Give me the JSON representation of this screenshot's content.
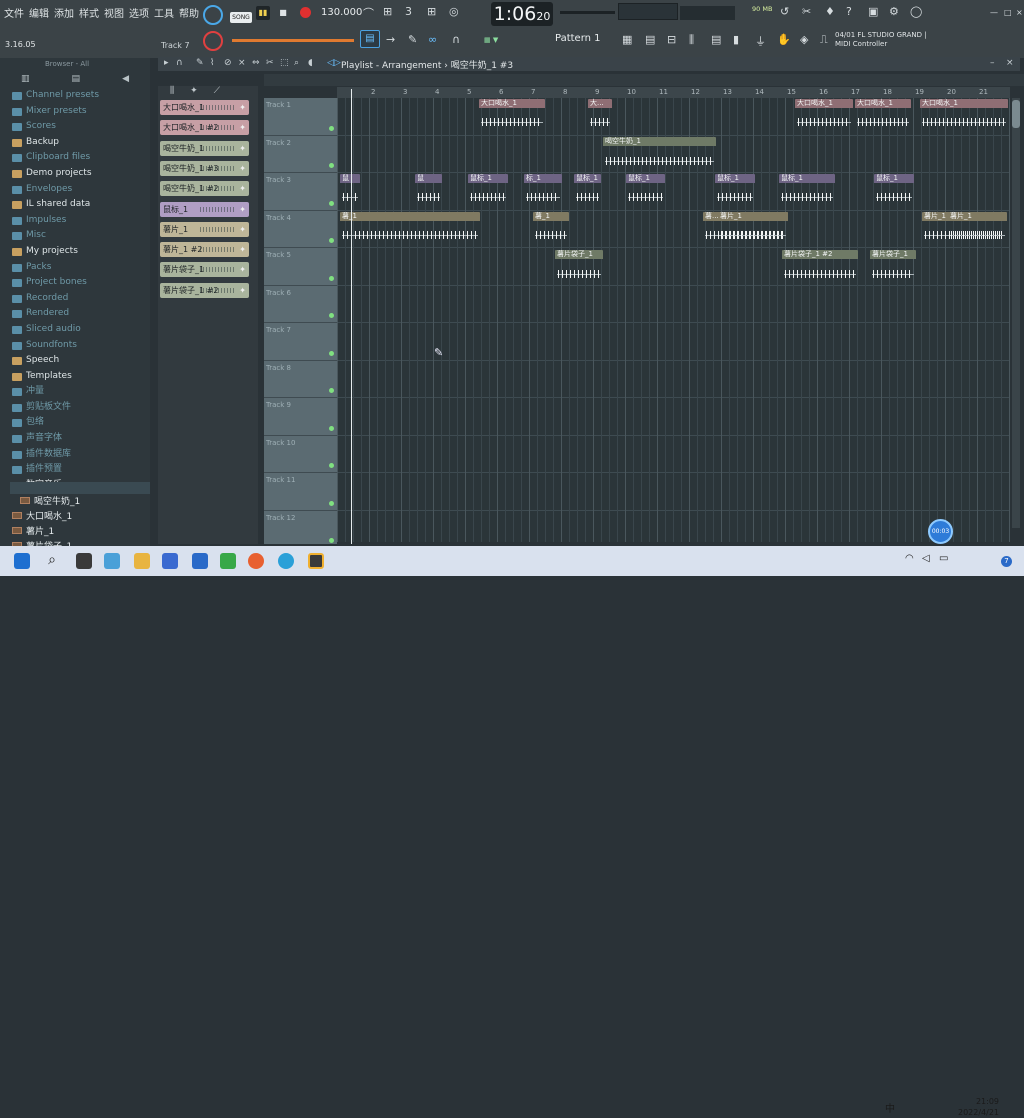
{
  "menu": {
    "items": [
      "文件",
      "编辑",
      "添加",
      "样式",
      "视图",
      "选项",
      "工具",
      "帮助"
    ]
  },
  "transport": {
    "song_label": "SONG",
    "play_symbol": "▮▮",
    "stop_symbol": "■",
    "tempo": "130.000",
    "time": "1:06",
    "time_sub": "20",
    "memory": "90 MB"
  },
  "hint_bar": {
    "left": "3.16.05",
    "track": "Track 7",
    "hint_line1": "04/01  FL STUDIO GRAND |",
    "hint_line2": "MIDI Controller"
  },
  "pattern": {
    "label": "Pattern 1",
    "snap_icon": "magnet-icon"
  },
  "browser": {
    "header": "Browser - All",
    "items": [
      {
        "label": "Channel presets",
        "style": "dim",
        "color": "#5a8fa8"
      },
      {
        "label": "Mixer presets",
        "style": "dim",
        "color": "#5a8fa8"
      },
      {
        "label": "Scores",
        "style": "dim",
        "color": "#5a8fa8"
      },
      {
        "label": "Backup",
        "style": "brt",
        "color": "#c8a060"
      },
      {
        "label": "Clipboard files",
        "style": "dim",
        "color": "#5a8fa8"
      },
      {
        "label": "Demo projects",
        "style": "brt",
        "color": "#c8a060"
      },
      {
        "label": "Envelopes",
        "style": "dim",
        "color": "#5a8fa8"
      },
      {
        "label": "IL shared data",
        "style": "brt",
        "color": "#c8a060"
      },
      {
        "label": "Impulses",
        "style": "dim",
        "color": "#5a8fa8"
      },
      {
        "label": "Misc",
        "style": "dim",
        "color": "#5a8fa8"
      },
      {
        "label": "My projects",
        "style": "brt",
        "color": "#c8a060"
      },
      {
        "label": "Packs",
        "style": "dim",
        "color": "#5a8fa8"
      },
      {
        "label": "Project bones",
        "style": "dim",
        "color": "#5a8fa8"
      },
      {
        "label": "Recorded",
        "style": "dim",
        "color": "#5a8fa8"
      },
      {
        "label": "Rendered",
        "style": "dim",
        "color": "#5a8fa8"
      },
      {
        "label": "Sliced audio",
        "style": "dim",
        "color": "#5a8fa8"
      },
      {
        "label": "Soundfonts",
        "style": "dim",
        "color": "#5a8fa8"
      },
      {
        "label": "Speech",
        "style": "brt",
        "color": "#c8a060"
      },
      {
        "label": "Templates",
        "style": "brt",
        "color": "#c8a060"
      },
      {
        "label": "冲量",
        "style": "dim",
        "color": "#5a8fa8"
      },
      {
        "label": "剪贴板文件",
        "style": "dim",
        "color": "#5a8fa8"
      },
      {
        "label": "包络",
        "style": "dim",
        "color": "#5a8fa8"
      },
      {
        "label": "声音字体",
        "style": "dim",
        "color": "#5a8fa8"
      },
      {
        "label": "插件数据库",
        "style": "dim",
        "color": "#5a8fa8"
      },
      {
        "label": "插件预置",
        "style": "dim",
        "color": "#5a8fa8"
      },
      {
        "label": "数字音乐",
        "style": "brt",
        "color": "#c8a060"
      }
    ],
    "files": [
      "喝空牛奶_1",
      "大口喝水_1",
      "薯片_1",
      "薯片袋子_1"
    ]
  },
  "playlist": {
    "title": "Playlist - Arrangement",
    "pattern": "喝空牛奶_1 #3",
    "ruler": [
      "2",
      "3",
      "4",
      "5",
      "6",
      "7",
      "8",
      "9",
      "10",
      "11",
      "12",
      "13",
      "14",
      "15",
      "16",
      "17",
      "18",
      "19",
      "20",
      "21"
    ],
    "tracks": [
      "Track 1",
      "Track 2",
      "Track 3",
      "Track 4",
      "Track 5",
      "Track 6",
      "Track 7",
      "Track 8",
      "Track 9",
      "Track 10",
      "Track 11",
      "Track 12"
    ]
  },
  "channels": [
    {
      "label": "大口喝水_1",
      "color": "#c79fa5"
    },
    {
      "label": "大口喝水_1 #2",
      "color": "#c79fa5"
    },
    {
      "label": "喝空牛奶_1",
      "color": "#a9b49d"
    },
    {
      "label": "喝空牛奶_1 #3",
      "color": "#a9b49d"
    },
    {
      "label": "喝空牛奶_1 #2",
      "color": "#a9b49d"
    },
    {
      "label": "鼠标_1",
      "color": "#b09ec4"
    },
    {
      "label": "薯片_1",
      "color": "#bfb698"
    },
    {
      "label": "薯片_1 #2",
      "color": "#bfb698"
    },
    {
      "label": "薯片袋子_1",
      "color": "#a9b49d"
    },
    {
      "label": "薯片袋子_1 #2",
      "color": "#a9b49d"
    }
  ],
  "clips": {
    "row0": [
      [
        "大口喝水_1",
        "#c79fa5"
      ],
      [
        "大...",
        "#c79fa5"
      ],
      [
        "大口喝水_1",
        "#c79fa5"
      ],
      [
        "大口喝水_1",
        "#c79fa5"
      ],
      [
        "大口喝水_1",
        "#c79fa5"
      ]
    ],
    "row1": [
      [
        "喝空牛奶_1",
        "#a9b49d"
      ]
    ],
    "row2": [
      [
        "鼠",
        "#b09ec4"
      ],
      [
        "鼠",
        "#b09ec4"
      ],
      [
        "鼠标_1",
        "#b09ec4"
      ],
      [
        "标_1",
        "#b09ec4"
      ],
      [
        "鼠标_1",
        "#b09ec4"
      ],
      [
        "鼠标_1",
        "#b09ec4"
      ],
      [
        "鼠标_1",
        "#b09ec4"
      ],
      [
        "鼠标_1",
        "#b09ec4"
      ],
      [
        "鼠标_1",
        "#b09ec4"
      ]
    ],
    "row3": [
      [
        "薯_1",
        "#bfb698"
      ],
      [
        "薯_1",
        "#bfb698"
      ],
      [
        "薯...",
        "#bfb698"
      ],
      [
        "薯片_1",
        "#bfb698"
      ],
      [
        "薯片_1",
        "#bfb698"
      ],
      [
        "薯片_1",
        "#bfb698"
      ]
    ],
    "row4": [
      [
        "薯片袋子_1",
        "#a9b49d"
      ],
      [
        "薯片袋子_1 #2",
        "#a9b49d"
      ],
      [
        "薯片袋子_1",
        "#a9b49d"
      ]
    ]
  },
  "timer_bubble": "00:03",
  "system": {
    "lang": "中",
    "time": "21:09",
    "date": "2022/4/21",
    "notify": "7"
  }
}
